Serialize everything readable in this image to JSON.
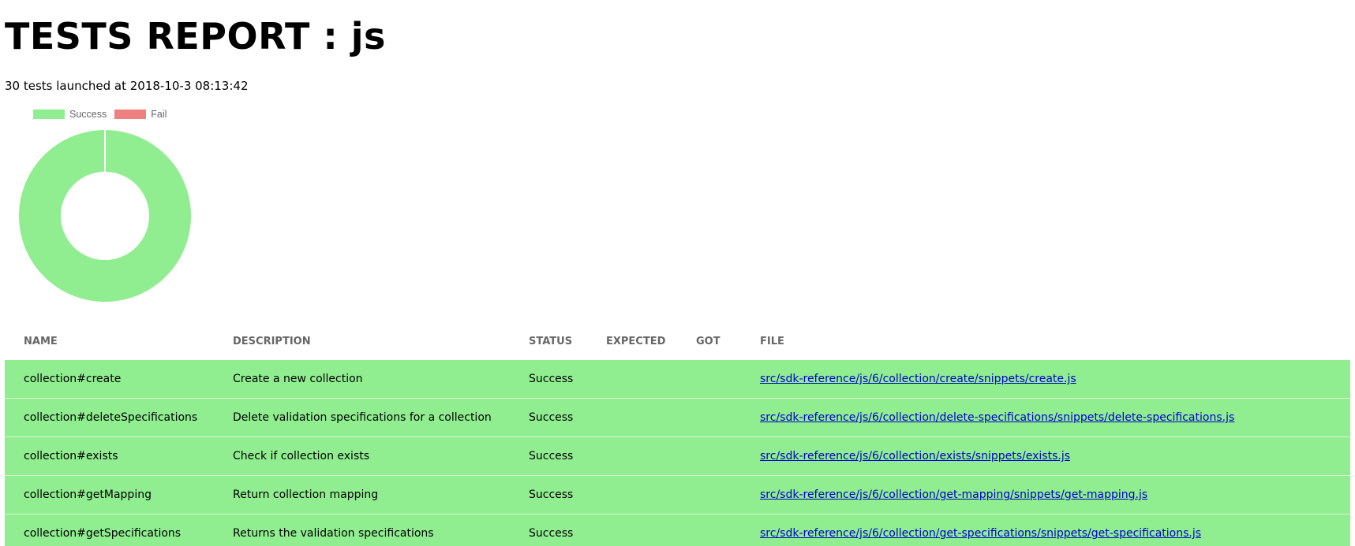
{
  "report": {
    "title": "TESTS REPORT : js",
    "summary": "30 tests launched at 2018-10-3 08:13:42"
  },
  "chart_data": {
    "type": "pie",
    "donut": true,
    "categories": [
      "Success",
      "Fail"
    ],
    "values": [
      30,
      0
    ],
    "colors": [
      "#90ee90",
      "#f08080"
    ],
    "legend_position": "top-left"
  },
  "table": {
    "columns": [
      "NAME",
      "DESCRIPTION",
      "STATUS",
      "EXPECTED",
      "GOT",
      "FILE"
    ],
    "rows": [
      {
        "name": "collection#create",
        "description": "Create a new collection",
        "status": "Success",
        "expected": "",
        "got": "",
        "file": "src/sdk-reference/js/6/collection/create/snippets/create.js"
      },
      {
        "name": "collection#deleteSpecifications",
        "description": "Delete validation specifications for a collection",
        "status": "Success",
        "expected": "",
        "got": "",
        "file": "src/sdk-reference/js/6/collection/delete-specifications/snippets/delete-specifications.js"
      },
      {
        "name": "collection#exists",
        "description": "Check if collection exists",
        "status": "Success",
        "expected": "",
        "got": "",
        "file": "src/sdk-reference/js/6/collection/exists/snippets/exists.js"
      },
      {
        "name": "collection#getMapping",
        "description": "Return collection mapping",
        "status": "Success",
        "expected": "",
        "got": "",
        "file": "src/sdk-reference/js/6/collection/get-mapping/snippets/get-mapping.js"
      },
      {
        "name": "collection#getSpecifications",
        "description": "Returns the validation specifications",
        "status": "Success",
        "expected": "",
        "got": "",
        "file": "src/sdk-reference/js/6/collection/get-specifications/snippets/get-specifications.js"
      }
    ]
  },
  "colors": {
    "success_row": "#90ee90",
    "link": "#0000cc",
    "header_text": "#666666"
  }
}
